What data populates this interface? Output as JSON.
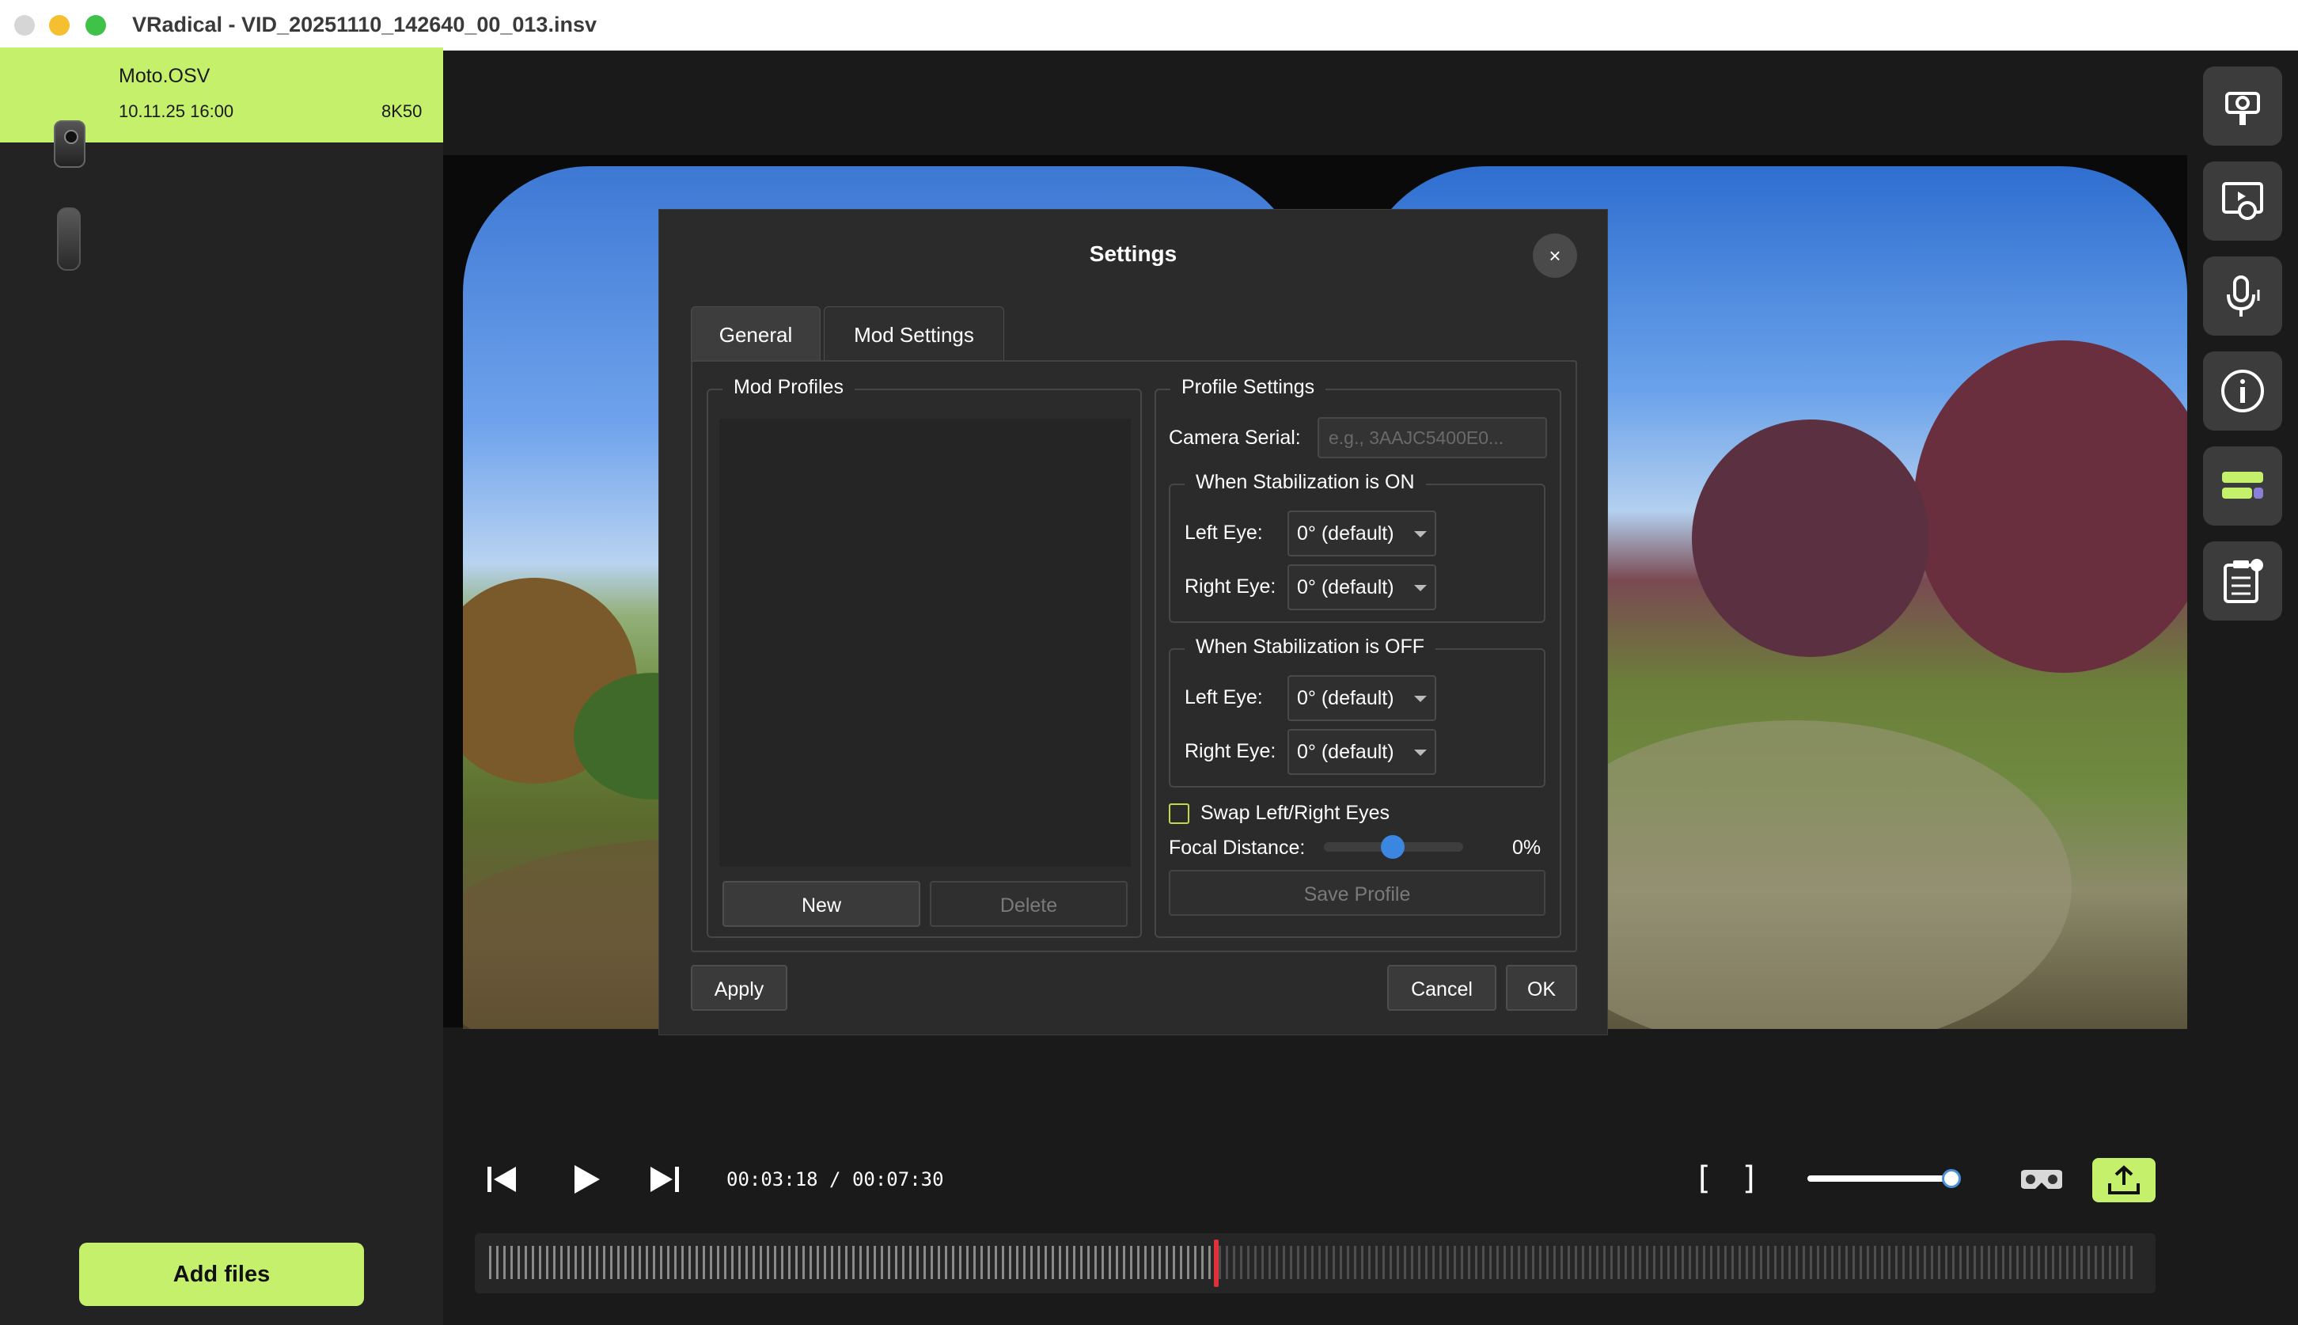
{
  "window": {
    "title": "VRadical - VID_20251110_142640_00_013.insv"
  },
  "sidebar": {
    "files": [
      {
        "name": "Moto.OSV",
        "date": "10.11.25 16:00",
        "resolution": "8K50"
      }
    ],
    "add_files_label": "Add files"
  },
  "player": {
    "timecode": "00:03:18 / 00:07:30",
    "mark_in": "[",
    "mark_out": "]",
    "zoom_level": 0.98,
    "playhead_fraction": 0.44
  },
  "right_toolbar": {
    "icons": [
      "camera-rig-icon",
      "video-settings-icon",
      "microphone-audio-icon",
      "info-icon",
      "layout-bars-icon",
      "clipboard-list-icon"
    ]
  },
  "settings_dialog": {
    "title": "Settings",
    "close_label": "×",
    "tabs": [
      {
        "label": "General"
      },
      {
        "label": "Mod Settings"
      }
    ],
    "mod_profiles": {
      "title": "Mod Profiles",
      "new_label": "New",
      "delete_label": "Delete"
    },
    "profile_settings": {
      "title": "Profile Settings",
      "camera_serial_label": "Camera Serial:",
      "camera_serial_placeholder": "e.g., 3AAJC5400E0...",
      "stab_on": {
        "title": "When Stabilization is ON",
        "left_eye_label": "Left Eye:",
        "left_eye_value": "0° (default)",
        "right_eye_label": "Right Eye:",
        "right_eye_value": "0° (default)"
      },
      "stab_off": {
        "title": "When Stabilization is OFF",
        "left_eye_label": "Left Eye:",
        "left_eye_value": "0° (default)",
        "right_eye_label": "Right Eye:",
        "right_eye_value": "0° (default)"
      },
      "swap_label": "Swap Left/Right Eyes",
      "swap_checked": false,
      "focal_label": "Focal Distance:",
      "focal_value": "0%",
      "save_label": "Save Profile"
    },
    "apply_label": "Apply",
    "cancel_label": "Cancel",
    "ok_label": "OK"
  },
  "colors": {
    "accent": "#c5f06c",
    "playhead": "#e0303a",
    "slider": "#3a86e0"
  }
}
